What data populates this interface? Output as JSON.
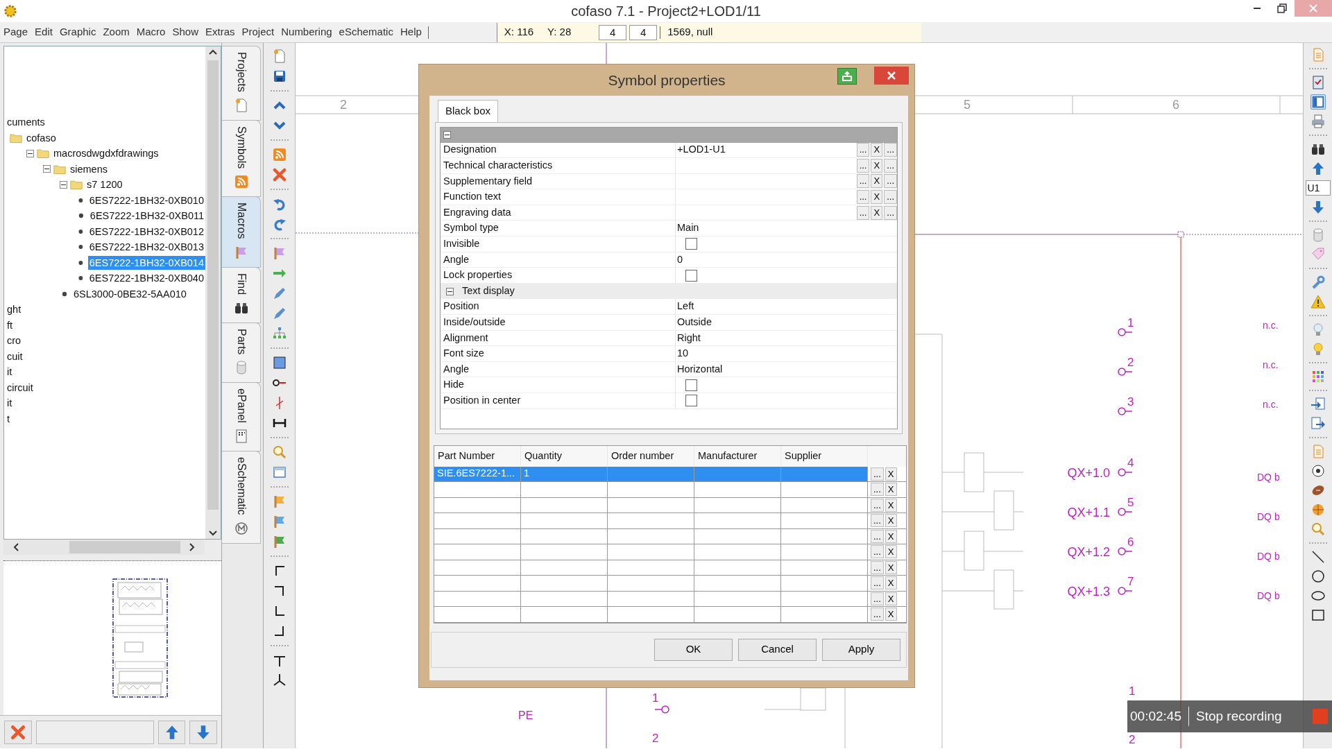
{
  "window": {
    "title": "cofaso 7.1 - Project2+LOD1/11"
  },
  "menu": [
    "Page",
    "Edit",
    "Graphic",
    "Zoom",
    "Macro",
    "Show",
    "Extras",
    "Project",
    "Numbering",
    "eSchematic",
    "Help"
  ],
  "status": {
    "x": "X: 116",
    "y": "Y: 28",
    "field_1": "4",
    "field_2": "4",
    "info": "1569, null"
  },
  "tree": [
    {
      "label": "cuments",
      "children": [
        {
          "label": "cofaso",
          "kind": "folder",
          "children": [
            {
              "label": "macrosdwgdxfdrawings",
              "kind": "folder",
              "expanded": true,
              "children": [
                {
                  "label": "siemens",
                  "kind": "folder",
                  "expanded": true,
                  "children": [
                    {
                      "label": "s7 1200",
                      "kind": "folder",
                      "expanded": true,
                      "children": [
                        {
                          "label": "6ES7222-1BH32-0XB010",
                          "kind": "macro",
                          "selected": false
                        },
                        {
                          "label": "6ES7222-1BH32-0XB011",
                          "kind": "macro",
                          "selected": false
                        },
                        {
                          "label": "6ES7222-1BH32-0XB012",
                          "kind": "macro",
                          "selected": false
                        },
                        {
                          "label": "6ES7222-1BH32-0XB013",
                          "kind": "macro",
                          "selected": false
                        },
                        {
                          "label": "6ES7222-1BH32-0XB014",
                          "kind": "macro",
                          "selected": true
                        },
                        {
                          "label": "6ES7222-1BH32-0XB040",
                          "kind": "macro",
                          "selected": false
                        }
                      ]
                    },
                    {
                      "label": "6SL3000-0BE32-5AA010",
                      "kind": "macro",
                      "selected": false
                    }
                  ]
                }
              ]
            }
          ]
        }
      ]
    },
    {
      "label": "ght"
    },
    {
      "label": "ft"
    },
    {
      "label": "cro"
    },
    {
      "label": "cuit"
    },
    {
      "label": "it"
    },
    {
      "label": "circuit"
    },
    {
      "label": "it"
    },
    {
      "label": "t"
    }
  ],
  "side_tabs": [
    {
      "label": "Projects",
      "selected": false
    },
    {
      "label": "Symbols",
      "selected": false
    },
    {
      "label": "Macros",
      "selected": true
    },
    {
      "label": "Find",
      "selected": false
    },
    {
      "label": "Parts",
      "selected": false
    },
    {
      "label": "ePanel",
      "selected": false
    },
    {
      "label": "eSchematic",
      "selected": false
    }
  ],
  "toolbar_field": "U1",
  "canvas": {
    "column_numbers": [
      "2",
      "5",
      "6"
    ],
    "spare_terminals": [
      {
        "number": "1",
        "note": "n.c."
      },
      {
        "number": "2",
        "note": "n.c."
      },
      {
        "number": "3",
        "note": "n.c."
      }
    ],
    "output_terminals": [
      {
        "number": "4",
        "label": "QX+1.0",
        "note": "DQ b"
      },
      {
        "number": "5",
        "label": "QX+1.1",
        "note": "DQ b"
      },
      {
        "number": "6",
        "label": "QX+1.2",
        "note": "DQ b"
      },
      {
        "number": "7",
        "label": "QX+1.3",
        "note": "DQ b"
      }
    ],
    "ground_label": "PE",
    "lower_terminals": [
      "1",
      "2"
    ],
    "lower_right_terminals": [
      "1",
      "2"
    ]
  },
  "dialog": {
    "title": "Symbol properties",
    "tabs": [
      {
        "label": "Black box",
        "selected": true
      }
    ],
    "groups": [
      {
        "expanded": true,
        "rows": [
          {
            "label": "Designation",
            "kind": "text",
            "value": "+LOD1-U1",
            "buttons": [
              "...",
              "X",
              "..."
            ]
          },
          {
            "label": "Technical characteristics",
            "kind": "text",
            "buttons": [
              "...",
              "X",
              "..."
            ]
          },
          {
            "label": "Supplementary field",
            "kind": "text",
            "buttons": [
              "...",
              "X",
              "..."
            ]
          },
          {
            "label": "Function text",
            "kind": "text",
            "buttons": [
              "...",
              "X",
              "..."
            ]
          },
          {
            "label": "Engraving data",
            "kind": "text",
            "buttons": [
              "...",
              "X",
              "..."
            ]
          },
          {
            "label": "Symbol type",
            "kind": "value",
            "value": "Main"
          },
          {
            "label": "Invisible",
            "kind": "checkbox",
            "checked": false
          },
          {
            "label": "Angle",
            "kind": "value",
            "value": "0"
          },
          {
            "label": "Lock properties",
            "kind": "checkbox",
            "checked": false
          }
        ]
      },
      {
        "title": "Text display",
        "expanded": true,
        "rows": [
          {
            "label": "Position",
            "kind": "value",
            "value": "Left"
          },
          {
            "label": "Inside/outside",
            "kind": "value",
            "value": "Outside"
          },
          {
            "label": "Alignment",
            "kind": "value",
            "value": "Right"
          },
          {
            "label": "Font size",
            "kind": "value",
            "value": "10"
          },
          {
            "label": "Angle",
            "kind": "value",
            "value": "Horizontal"
          },
          {
            "label": "Hide",
            "kind": "checkbox",
            "checked": false
          },
          {
            "label": "Position in center",
            "kind": "checkbox",
            "checked": false
          }
        ]
      }
    ],
    "table": {
      "columns": [
        "Part Number",
        "Quantity",
        "Order number",
        "Manufacturer",
        "Supplier"
      ],
      "rows": [
        {
          "cells": [
            "SIE.6ES7222-1...",
            "1"
          ],
          "selected": true,
          "actions": [
            "...",
            "X"
          ]
        },
        {
          "selected": false,
          "actions": [
            "...",
            "X"
          ]
        },
        {
          "selected": false,
          "actions": [
            "...",
            "X"
          ]
        },
        {
          "selected": false,
          "actions": [
            "...",
            "X"
          ]
        },
        {
          "selected": false,
          "actions": [
            "...",
            "X"
          ]
        },
        {
          "selected": false,
          "actions": [
            "...",
            "X"
          ]
        },
        {
          "selected": false,
          "actions": [
            "...",
            "X"
          ]
        },
        {
          "selected": false,
          "actions": [
            "...",
            "X"
          ]
        },
        {
          "selected": false,
          "actions": [
            "...",
            "X"
          ]
        },
        {
          "selected": false,
          "actions": [
            "...",
            "X"
          ]
        }
      ]
    },
    "buttons": [
      "OK",
      "Cancel",
      "Apply"
    ]
  },
  "recording": {
    "time": "00:02:45",
    "action": "Stop recording"
  }
}
